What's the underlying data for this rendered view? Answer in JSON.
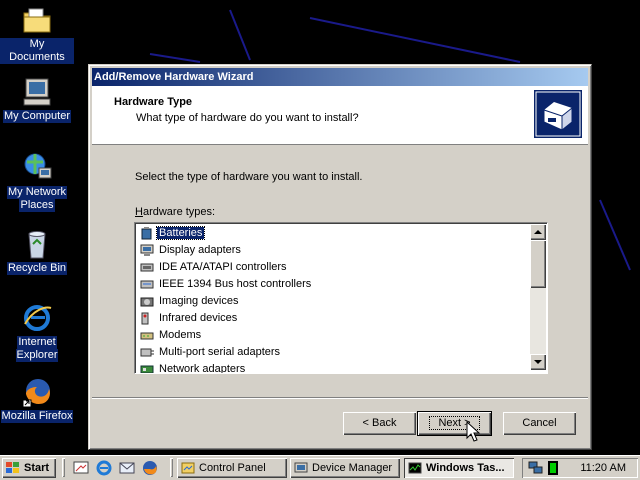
{
  "desktop": {
    "icons": [
      {
        "label": "My Documents",
        "icon": "folder-icon"
      },
      {
        "label": "My Computer",
        "icon": "computer-icon"
      },
      {
        "label_line1": "My Network",
        "label_line2": "Places",
        "icon": "network-icon"
      },
      {
        "label": "Recycle Bin",
        "icon": "recycle-bin-icon"
      },
      {
        "label_line1": "Internet",
        "label_line2": "Explorer",
        "icon": "internet-explorer-icon"
      },
      {
        "label": "Mozilla Firefox",
        "icon": "firefox-icon"
      }
    ]
  },
  "wizard": {
    "title": "Add/Remove Hardware Wizard",
    "header_title": "Hardware Type",
    "header_subtitle": "What type of hardware do you want to install?",
    "prompt": "Select the type of hardware you want to install.",
    "list_label_prefix": "H",
    "list_label_rest": "ardware types:",
    "hardware_types": [
      {
        "label": "Batteries",
        "selected": true,
        "icon": "battery-icon"
      },
      {
        "label": "Display adapters",
        "selected": false,
        "icon": "monitor-icon"
      },
      {
        "label": "IDE ATA/ATAPI controllers",
        "selected": false,
        "icon": "ide-controller-icon"
      },
      {
        "label": "IEEE 1394 Bus host controllers",
        "selected": false,
        "icon": "firewire-icon"
      },
      {
        "label": "Imaging devices",
        "selected": false,
        "icon": "camera-icon"
      },
      {
        "label": "Infrared devices",
        "selected": false,
        "icon": "infrared-icon"
      },
      {
        "label": "Modems",
        "selected": false,
        "icon": "modem-icon"
      },
      {
        "label": "Multi-port serial adapters",
        "selected": false,
        "icon": "serial-adapter-icon"
      },
      {
        "label": "Network adapters",
        "selected": false,
        "icon": "network-adapter-icon"
      }
    ],
    "buttons": {
      "back": "< Back",
      "next": "Next >",
      "cancel": "Cancel"
    }
  },
  "taskbar": {
    "start_label": "Start",
    "quick_launch": [
      "desktop-icon",
      "internet-explorer-icon",
      "outlook-icon",
      "firefox-icon"
    ],
    "tasks": [
      {
        "label": "Control Panel",
        "active": false
      },
      {
        "label": "Device Manager",
        "active": false
      },
      {
        "label": "Windows Tas...",
        "active": true
      }
    ],
    "clock": "11:20 AM"
  },
  "colors": {
    "title_active": "#0a246a",
    "title_gradient_end": "#a6caf0",
    "face": "#d4d0c8",
    "selection": "#0a246a",
    "desktop": "#000000"
  }
}
